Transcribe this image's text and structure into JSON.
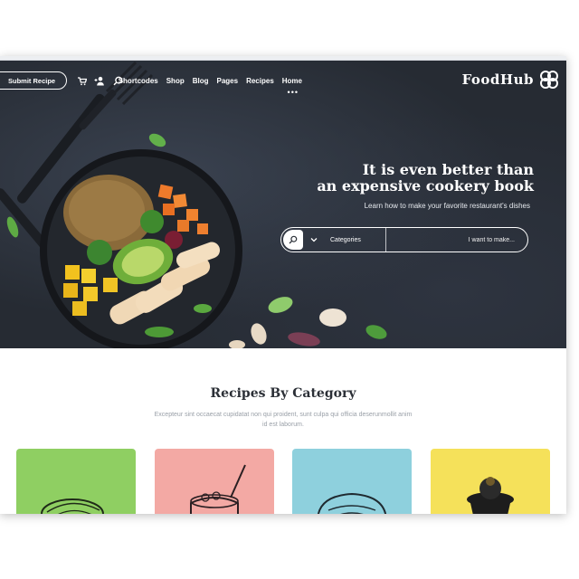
{
  "brand": {
    "name": "FoodHub"
  },
  "nav": {
    "items": [
      "Home",
      "Recipes",
      "Pages",
      "Blog",
      "Shop",
      "Shortcodes"
    ],
    "more": "•••",
    "submit_label": "Submit Recipe",
    "icons": [
      "search-icon",
      "user-plus-icon",
      "cart-icon"
    ]
  },
  "hero": {
    "title_line1": "It is even better than",
    "title_line2": "an expensive cookery book",
    "subtitle": "Learn how to make your favorite restaurant's dishes"
  },
  "search": {
    "placeholder": "I want to make...",
    "category_label": "Categories"
  },
  "category_section": {
    "title": "Recipes By Category",
    "description": "Excepteur sint occaecat cupidatat non qui proident, sunt culpa qui officia deserunmollit anim id est laborum."
  },
  "cards": [
    {
      "color": "#f5e15a",
      "icon": "cupcake-icon"
    },
    {
      "color": "#8ed0dd",
      "icon": "bread-icon"
    },
    {
      "color": "#f3a9a4",
      "icon": "pot-icon"
    },
    {
      "color": "#8fcf62",
      "icon": "pie-icon"
    }
  ]
}
